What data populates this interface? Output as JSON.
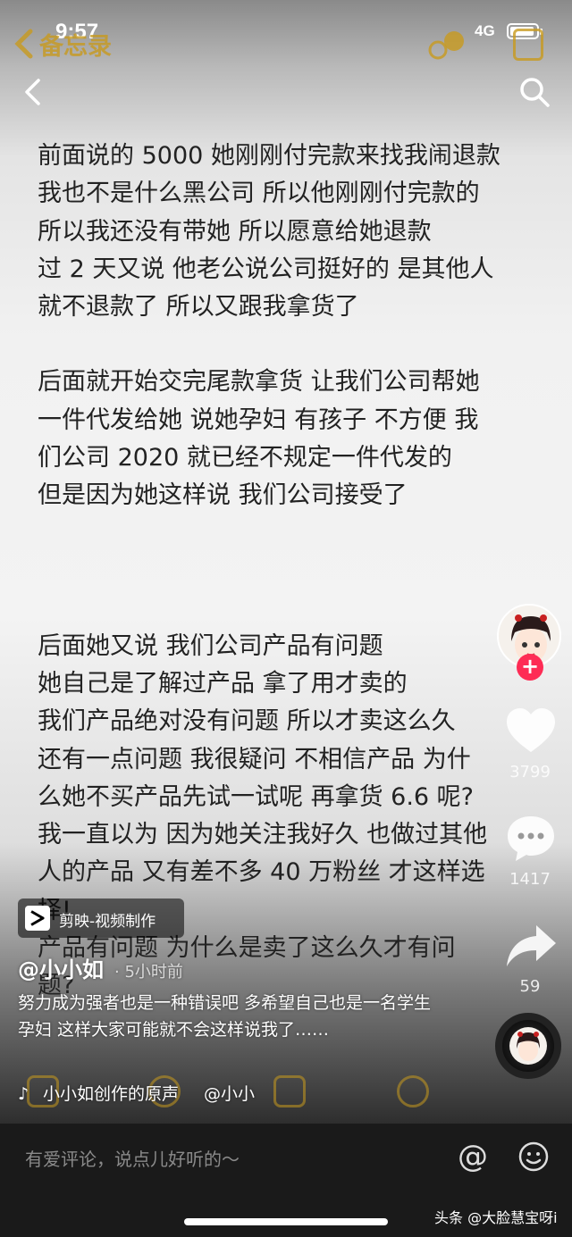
{
  "status_bar": {
    "time": "9:57",
    "network": "4G"
  },
  "memo_header": {
    "title": "备忘录"
  },
  "note": {
    "para1": [
      "前面说的 5000 她刚刚付完款来找我闹退款",
      "我也不是什么黑公司 所以他刚刚付完款的",
      "所以我还没有带她 所以愿意给她退款",
      "过 2 天又说 他老公说公司挺好的  是其他人",
      "就不退款了  所以又跟我拿货了"
    ],
    "para2": [
      "后面就开始交完尾款拿货   让我们公司帮她",
      "一件代发给她  说她孕妇 有孩子  不方便  我",
      "们公司 2020 就已经不规定一件代发的",
      "但是因为她这样说 我们公司接受了"
    ],
    "para3": [
      "后面她又说 我们公司产品有问题",
      "她自己是了解过产品  拿了用才卖的",
      "我们产品绝对没有问题 所以才卖这么久",
      "还有一点问题  我很疑问  不相信产品 为什",
      "么她不买产品先试一试呢 再拿货 6.6 呢?",
      "我一直以为 因为她关注我好久  也做过其他",
      "人的产品  又有差不多 40 万粉丝   才这样选",
      "择!",
      "产品有问题 为什么是卖了这么久才有问",
      "题?"
    ]
  },
  "capcut_badge": {
    "label": "剪映-视频制作"
  },
  "author": {
    "handle": "@小小如",
    "time": "· 5小时前"
  },
  "caption": "努力成为强者也是一种错误吧 多希望自己也是一名学生 孕妇 这样大家可能就不会这样说我了……",
  "music": {
    "title": "小小如创作的原声",
    "author": "@小小"
  },
  "actions": {
    "likes": "3799",
    "comments": "1417",
    "shares": "59"
  },
  "comment_bar": {
    "placeholder": "有爱评论，说点儿好听的～",
    "at_symbol": "@"
  },
  "watermark": "头条 @大脸慧宝呀i"
}
